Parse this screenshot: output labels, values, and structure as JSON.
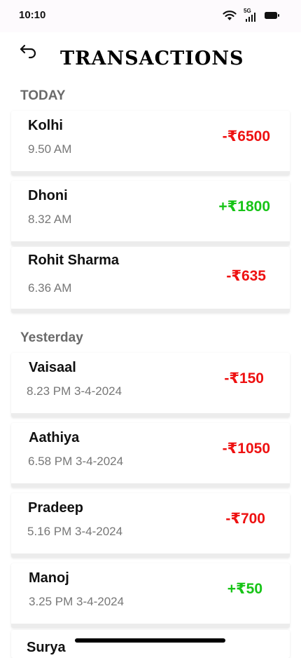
{
  "status_bar": {
    "time": "10:10",
    "network": "5G"
  },
  "header": {
    "title": "TRANSACTIONS",
    "back_icon": "back-arrow-icon"
  },
  "sections": [
    {
      "heading": "TODAY",
      "transactions": [
        {
          "name": "Kolhi",
          "time": "9.50 AM",
          "amount": "-₹6500",
          "type": "debit"
        },
        {
          "name": "Dhoni",
          "time": "8.32 AM",
          "amount": "+₹1800",
          "type": "credit"
        },
        {
          "name": "Rohit Sharma",
          "time": "6.36 AM",
          "amount": "-₹635",
          "type": "debit"
        }
      ]
    },
    {
      "heading": "Yesterday",
      "transactions": [
        {
          "name": "Vaisaal",
          "time": "8.23 PM 3-4-2024",
          "amount": "-₹150",
          "type": "debit"
        },
        {
          "name": "Aathiya",
          "time": "6.58 PM 3-4-2024",
          "amount": "-₹1050",
          "type": "debit"
        },
        {
          "name": "Pradeep",
          "time": "5.16 PM 3-4-2024",
          "amount": "-₹700",
          "type": "debit"
        },
        {
          "name": "Manoj",
          "time": "3.25 PM 3-4-2024",
          "amount": "+₹50",
          "type": "credit"
        },
        {
          "name": "Surya",
          "time": "",
          "amount": "",
          "type": "credit"
        }
      ]
    }
  ],
  "colors": {
    "debit": "#ee1111",
    "credit": "#17c417"
  }
}
